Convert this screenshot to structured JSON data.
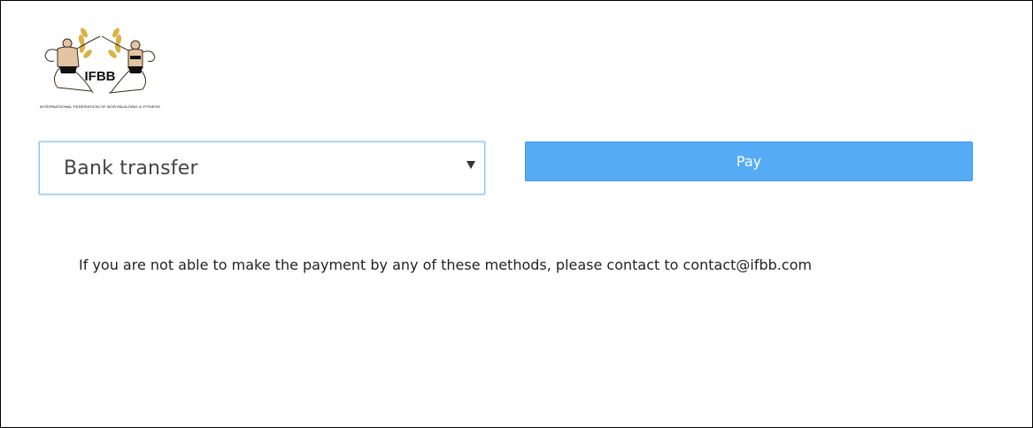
{
  "logo": {
    "icon": "ifbb-logo-icon",
    "text": "IFBB",
    "subtitle": "INTERNATIONAL FEDERATION OF BODYBUILDING & FITNESS"
  },
  "payment": {
    "method_selected": "Bank transfer",
    "pay_label": "Pay"
  },
  "notice": {
    "text": "If you are not able to make the payment by any of these methods, please contact to contact@ifbb.com"
  },
  "colors": {
    "pay_button": "#55acf5",
    "select_border": "#8fc1ec",
    "laurel_gold": "#d8b347"
  }
}
